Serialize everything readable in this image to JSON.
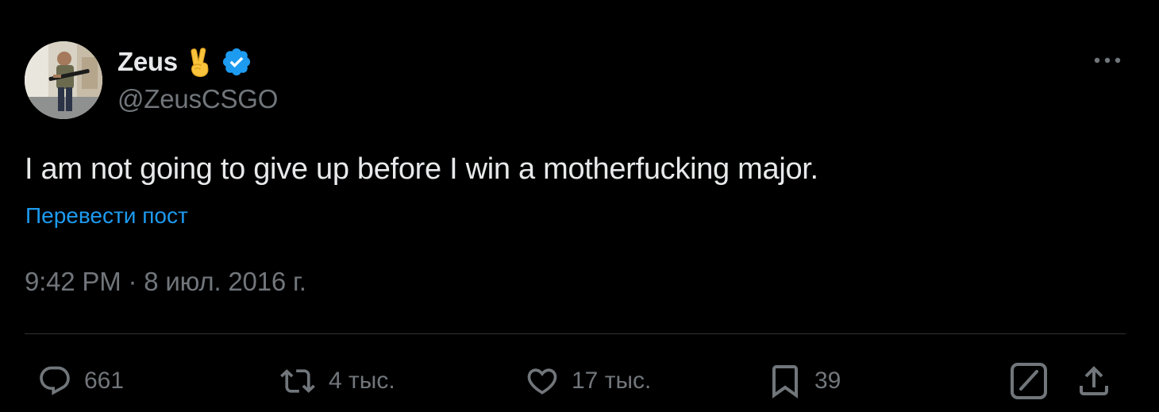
{
  "tweet": {
    "author": {
      "display_name": "Zeus",
      "emoji": "✌️",
      "verified": true,
      "handle": "@ZeusCSGO"
    },
    "text": "I am not going to give up before I win a motherfucking major.",
    "translate_label": "Перевести пост",
    "meta": {
      "time": "9:42 PM",
      "separator": "·",
      "date": "8 июл. 2016 г."
    },
    "actions": {
      "replies": "661",
      "reposts": "4 тыс.",
      "likes": "17 тыс.",
      "bookmarks": "39"
    }
  },
  "colors": {
    "background": "#000000",
    "text_primary": "#e7e9ea",
    "text_secondary": "#71767b",
    "accent": "#1d9bf0",
    "divider": "#2f3336"
  },
  "icons": {
    "more": "more-dots-icon",
    "reply": "reply-icon",
    "repost": "repost-icon",
    "like": "like-icon",
    "bookmark": "bookmark-icon",
    "grok": "grok-icon",
    "share": "share-icon"
  }
}
